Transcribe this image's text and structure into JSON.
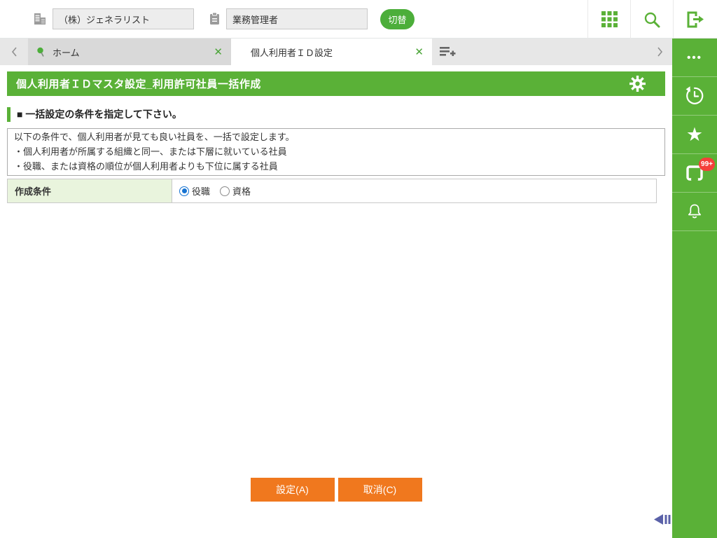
{
  "colors": {
    "accent_green": "#5ab137",
    "button_orange": "#f0781e",
    "badge_red": "#f4403a",
    "radio_blue": "#1673d2",
    "collapse_arrow_blue": "#5a61a8"
  },
  "icons": {
    "close": "✕",
    "ellipsis": "•••",
    "star": "★"
  },
  "topbar": {
    "company_value": "（株）ジェネラリスト",
    "role_value": "業務管理者",
    "switch_button": "切替"
  },
  "tabs": {
    "home": {
      "label": "ホーム"
    },
    "active": {
      "label": "個人利用者ＩＤ設定"
    }
  },
  "page": {
    "title": "個人利用者ＩＤマスタ設定_利用許可社員一括作成",
    "section_heading": "■ 一括設定の条件を指定して下さい。",
    "info_lines": [
      "以下の条件で、個人利用者が見ても良い社員を、一括で設定します。",
      "・個人利用者が所属する組織と同一、または下層に就いている社員",
      "・役職、または資格の順位が個人利用者よりも下位に属する社員"
    ],
    "form": {
      "label": "作成条件",
      "options": [
        "役職",
        "資格"
      ],
      "selected": "役職"
    },
    "buttons": {
      "submit": "設定(A)",
      "cancel": "取消(C)"
    }
  },
  "sidebar": {
    "notification_badge": "99+"
  }
}
